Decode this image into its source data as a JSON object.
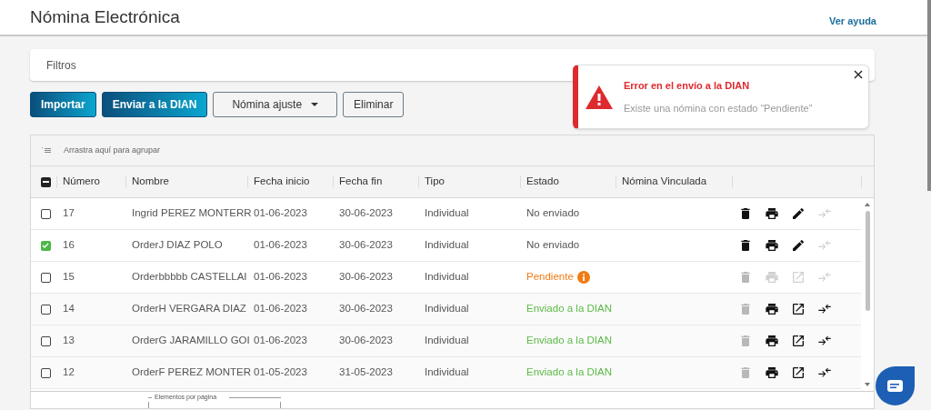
{
  "page_title": "Nómina Electrónica",
  "help_link": "Ver ayuda",
  "filters": {
    "label": "Filtros"
  },
  "toolbar": [
    {
      "label": "Importar",
      "kind": "primary"
    },
    {
      "label": "Enviar a la DIAN",
      "kind": "primary"
    },
    {
      "label": "Nómina ajuste",
      "kind": "dropdown"
    },
    {
      "label": "Eliminar",
      "kind": "outline"
    }
  ],
  "table": {
    "group_hint": "Arrastra aquí para agrupar",
    "select_all": {
      "indeterminate": true
    },
    "columns": [
      "Número",
      "Nombre",
      "Fecha inicio",
      "Fecha fin",
      "Tipo",
      "Estado",
      "Nómina Vinculada"
    ],
    "rows": [
      {
        "checked": false,
        "number": "17",
        "name": "Ingrid PEREZ MONTERR",
        "start": "01-06-2023",
        "end": "30-06-2023",
        "type": "Individual",
        "status": {
          "text": "No enviado",
          "color": "#555555"
        },
        "info": false,
        "actions": [
          {
            "kind": "delete",
            "disabled": false
          },
          {
            "kind": "print",
            "disabled": false
          },
          {
            "kind": "edit",
            "disabled": false
          },
          {
            "kind": "link",
            "disabled": true
          }
        ]
      },
      {
        "checked": true,
        "number": "16",
        "name": "OrderJ DIAZ POLO",
        "start": "01-06-2023",
        "end": "30-06-2023",
        "type": "Individual",
        "status": {
          "text": "No enviado",
          "color": "#555555"
        },
        "info": false,
        "actions": [
          {
            "kind": "delete",
            "disabled": false
          },
          {
            "kind": "print",
            "disabled": false
          },
          {
            "kind": "edit",
            "disabled": false
          },
          {
            "kind": "link",
            "disabled": true
          }
        ]
      },
      {
        "checked": false,
        "number": "15",
        "name": "Orderbbbbb CASTELLAI",
        "start": "01-06-2023",
        "end": "30-06-2023",
        "type": "Individual",
        "status": {
          "text": "Pendiente",
          "color": "#f07b15"
        },
        "info": true,
        "actions": [
          {
            "kind": "delete",
            "disabled": true
          },
          {
            "kind": "print",
            "disabled": true
          },
          {
            "kind": "open",
            "disabled": true
          },
          {
            "kind": "link",
            "disabled": true
          }
        ]
      },
      {
        "checked": false,
        "number": "14",
        "name": "OrderH VERGARA DIAZ",
        "start": "01-06-2023",
        "end": "30-06-2023",
        "type": "Individual",
        "status": {
          "text": "Enviado a la DIAN",
          "color": "#5cb946"
        },
        "info": false,
        "actions": [
          {
            "kind": "delete",
            "disabled": true
          },
          {
            "kind": "print",
            "disabled": false
          },
          {
            "kind": "open",
            "disabled": false
          },
          {
            "kind": "link",
            "disabled": false
          }
        ]
      },
      {
        "checked": false,
        "number": "13",
        "name": "OrderG JARAMILLO GOI",
        "start": "01-06-2023",
        "end": "30-06-2023",
        "type": "Individual",
        "status": {
          "text": "Enviado a la DIAN",
          "color": "#5cb946"
        },
        "info": false,
        "actions": [
          {
            "kind": "delete",
            "disabled": true
          },
          {
            "kind": "print",
            "disabled": false
          },
          {
            "kind": "open",
            "disabled": false
          },
          {
            "kind": "link",
            "disabled": false
          }
        ]
      },
      {
        "checked": false,
        "number": "12",
        "name": "OrderF PEREZ MONTER",
        "start": "01-05-2023",
        "end": "31-05-2023",
        "type": "Individual",
        "status": {
          "text": "Enviado a la DIAN",
          "color": "#5cb946"
        },
        "info": false,
        "actions": [
          {
            "kind": "delete",
            "disabled": true
          },
          {
            "kind": "print",
            "disabled": false
          },
          {
            "kind": "open",
            "disabled": false
          },
          {
            "kind": "link",
            "disabled": false
          }
        ]
      }
    ],
    "page_size_label": "Elementos por página"
  },
  "toast": {
    "title": "Error en el envío a la DIAN",
    "message": "Existe una nómina con estado “Pendiente”"
  }
}
